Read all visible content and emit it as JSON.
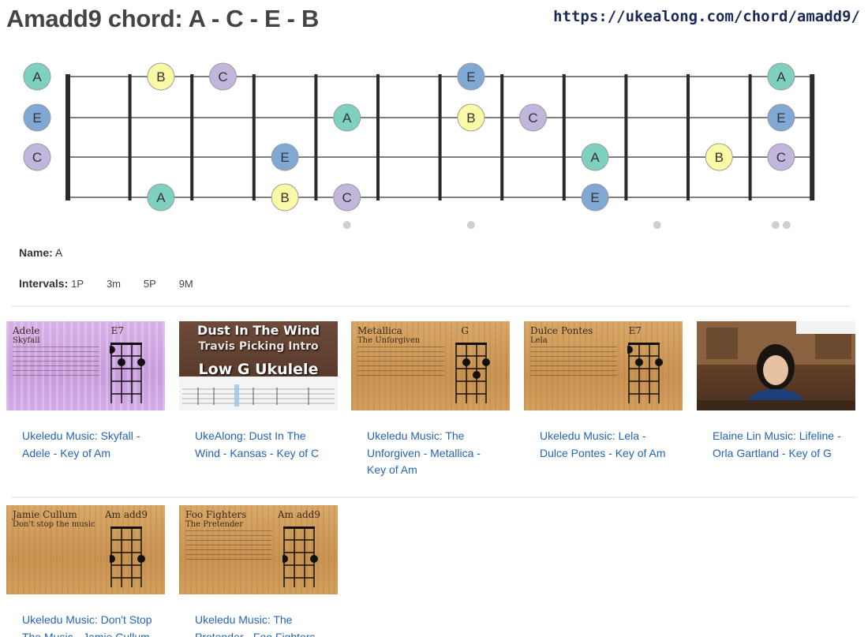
{
  "page": {
    "title": "Amadd9 chord: A - C - E - B",
    "url": "https://ukealong.com/chord/amadd9/"
  },
  "colors": {
    "A": "#7fd1bf",
    "B": "#fafaa6",
    "C": "#c3b6dc",
    "E": "#7fa9d4",
    "fret": "#2a2a2a",
    "string": "#555555",
    "inlay": "#cfcfcf"
  },
  "fretboard": {
    "frets_shown": 12,
    "open_strings": [
      "A",
      "E",
      "C"
    ],
    "notes": [
      {
        "string": 1,
        "fret": 0,
        "note": "A"
      },
      {
        "string": 1,
        "fret": 2,
        "note": "B"
      },
      {
        "string": 1,
        "fret": 3,
        "note": "C"
      },
      {
        "string": 1,
        "fret": 7,
        "note": "E"
      },
      {
        "string": 1,
        "fret": 12,
        "note": "A"
      },
      {
        "string": 2,
        "fret": 0,
        "note": "E"
      },
      {
        "string": 2,
        "fret": 5,
        "note": "A"
      },
      {
        "string": 2,
        "fret": 7,
        "note": "B"
      },
      {
        "string": 2,
        "fret": 8,
        "note": "C"
      },
      {
        "string": 2,
        "fret": 12,
        "note": "E"
      },
      {
        "string": 3,
        "fret": 0,
        "note": "C"
      },
      {
        "string": 3,
        "fret": 4,
        "note": "E"
      },
      {
        "string": 3,
        "fret": 9,
        "note": "A"
      },
      {
        "string": 3,
        "fret": 11,
        "note": "B"
      },
      {
        "string": 3,
        "fret": 12,
        "note": "C"
      },
      {
        "string": 4,
        "fret": 2,
        "note": "A"
      },
      {
        "string": 4,
        "fret": 4,
        "note": "B"
      },
      {
        "string": 4,
        "fret": 5,
        "note": "C"
      },
      {
        "string": 4,
        "fret": 9,
        "note": "E"
      }
    ],
    "inlays": [
      5,
      7,
      10,
      12
    ]
  },
  "info": {
    "name_label": "Name:",
    "name_value": "A",
    "intervals_label": "Intervals:",
    "intervals": [
      "1P",
      "3m",
      "5P",
      "9M"
    ]
  },
  "videos": [
    {
      "caption": "Ukeledu Music: Skyfall - Adele - Key of Am",
      "thumb_artist": "Adele",
      "thumb_song": "Skyfall",
      "thumb_chord": "E7",
      "style": "purple"
    },
    {
      "caption": "UkeAlong: Dust In The Wind - Kansas - Key of C",
      "thumb_line1": "Dust In The Wind",
      "thumb_line2": "Travis Picking Intro",
      "thumb_line3": "Low G Ukulele",
      "style": "tab"
    },
    {
      "caption": "Ukeledu Music: The Unforgiven - Metallica - Key of Am",
      "thumb_artist": "Metallica",
      "thumb_song": "The Unforgiven",
      "thumb_chord": "G",
      "style": "wood"
    },
    {
      "caption": "Ukeledu Music: Lela - Dulce Pontes - Key of Am",
      "thumb_artist": "Dulce Pontes",
      "thumb_song": "Lela",
      "thumb_chord": "E7",
      "style": "wood"
    },
    {
      "caption": "Elaine Lin Music: Lifeline - Orla Gartland - Key of G",
      "style": "photo"
    },
    {
      "caption": "Ukeledu Music: Don't Stop The Music - Jamie Cullum - Key of Am",
      "thumb_artist": "Jamie Cullum",
      "thumb_song": "Don't stop the music",
      "thumb_chord": "Am add9",
      "style": "wood"
    },
    {
      "caption": "Ukeledu Music: The Pretender - Foo Fighters - Key of Am",
      "thumb_artist": "Foo Fighters",
      "thumb_song": "The Pretender",
      "thumb_chord": "Am add9",
      "style": "wood"
    }
  ]
}
